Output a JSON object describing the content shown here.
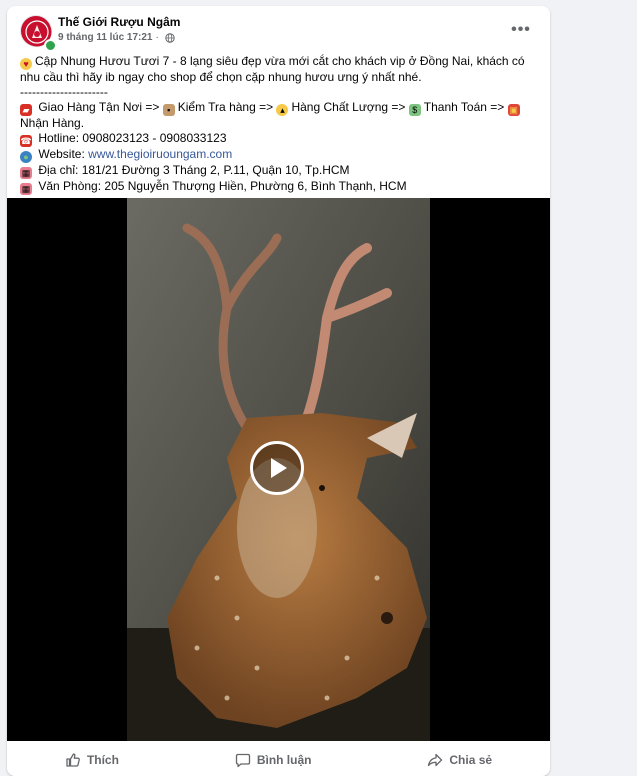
{
  "post": {
    "page_name": "Thế Giới Rượu Ngâm",
    "timestamp": "9 tháng 11 lúc 17:21",
    "meta_separator": "·",
    "privacy_icon": "globe-icon",
    "more_icon": "more-options-icon",
    "more_label": "•••",
    "status_color": "#31a24c",
    "brand_color": "#c8102e",
    "link_color": "#385898"
  },
  "body": {
    "line1": "Cập Nhung Hươu Tươi 7 - 8 lạng siêu đẹp vừa mới cắt cho khách vip ở Đồng Nai, khách có nhu cầu thì hãy ib ngay cho shop để chọn cặp nhung hươu ưng ý nhất nhé.",
    "divider": "----------------------",
    "delivery_line": " Giao Hàng Tận Nơi => ",
    "check_line": "Kiểm Tra hàng => ",
    "quality_line": "Hàng Chất Lượng => ",
    "payment_line": "Thanh Toán => ",
    "receive_line": "Nhận Hàng.",
    "hotline_label": " Hotline: ",
    "hotline_value": "0908023123 - 0908033123",
    "website_label": " Website: ",
    "website_value": "www.thegioiruoungam.com",
    "address_label": " Địa chỉ: ",
    "address_value": "181/21 Đường 3 Tháng 2, P.11, Quận 10, Tp.HCM",
    "office_label": " Văn Phòng: ",
    "office_value": "205 Nguyễn Thượng Hiền, Phường 6, Bình Thạnh, HCM",
    "emoji_icons": [
      "heart-eyes-emoji",
      "motorbike-emoji",
      "package-emoji",
      "thumbs-up-emoji",
      "money-emoji",
      "gift-emoji",
      "phone-emoji",
      "globe-emoji",
      "building-emoji"
    ]
  },
  "video": {
    "play_icon": "play-icon",
    "subject_image": "deer-with-velvet-antlers-photo"
  },
  "actions": {
    "like_label": "Thích",
    "comment_label": "Bình luận",
    "share_label": "Chia sẻ",
    "like_icon": "thumbs-up-icon",
    "comment_icon": "comment-icon",
    "share_icon": "share-icon"
  }
}
